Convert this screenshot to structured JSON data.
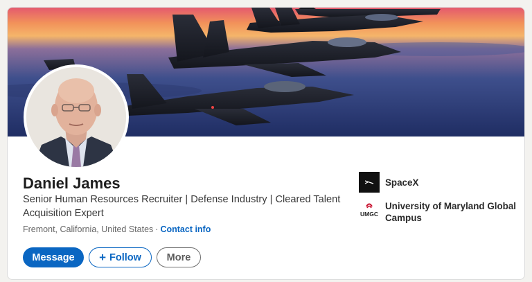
{
  "profile": {
    "name": "Daniel James",
    "headline": "Senior Human Resources Recruiter | Defense Industry | Cleared Talent Acquisition Expert",
    "location": "Fremont, California, United States",
    "separator": "·",
    "contact_info_label": "Contact info"
  },
  "actions": {
    "message_label": "Message",
    "follow_label": "Follow",
    "follow_icon": "+",
    "more_label": "More"
  },
  "organizations": [
    {
      "name": "SpaceX",
      "logo_icon": "spacex-logo"
    },
    {
      "name": "University of Maryland Global Campus",
      "logo_icon": "umgc-logo",
      "logo_text": "UMGC"
    }
  ],
  "colors": {
    "accent": "#0a66c2",
    "sky_top": "#f59a5c",
    "sky_bottom": "#2b3a73"
  },
  "banner": {
    "description_icon": "fighter-jets-sunset-image"
  },
  "avatar": {
    "icon": "profile-photo"
  }
}
